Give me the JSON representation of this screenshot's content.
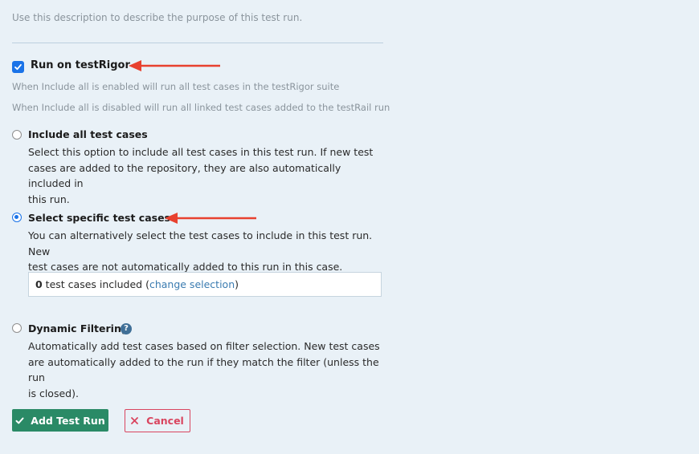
{
  "description_hint": "Use this description to describe the purpose of this test run.",
  "run_on": {
    "label": "Run on testRigor",
    "checked": true,
    "hint_enabled": "When Include all is enabled will run all test cases in the testRigor suite",
    "hint_disabled": "When Include all is disabled will run all linked test cases added to the testRail run"
  },
  "options": {
    "include_all": {
      "title": "Include all test cases",
      "desc1": "Select this option to include all test cases in this test run. If new test",
      "desc2": "cases are added to the repository, they are also automatically included in",
      "desc3": "this run.",
      "selected": false
    },
    "select_specific": {
      "title": "Select specific test cases",
      "desc1": "You can alternatively select the test cases to include in this test run. New",
      "desc2": "test cases are not automatically added to this run in this case.",
      "selected": true,
      "count": "0",
      "count_text": " test cases included (",
      "change_link": "change selection",
      "close_paren": ")"
    },
    "dynamic": {
      "title": "Dynamic Filtering",
      "help_icon": "?",
      "desc1": "Automatically add test cases based on filter selection. New test cases",
      "desc2": "are automatically added to the run if they match the filter (unless the run",
      "desc3": "is closed).",
      "selected": false
    }
  },
  "buttons": {
    "add": "Add Test Run",
    "cancel": "Cancel"
  },
  "colors": {
    "accent": "#1a73e8",
    "annotation_arrow": "#e8412f",
    "add_button": "#2a8a66",
    "cancel": "#d9455f"
  }
}
